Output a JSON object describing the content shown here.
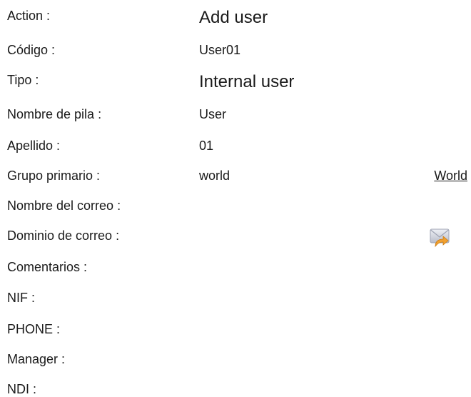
{
  "fields": {
    "action": {
      "label": "Action :",
      "value": "Add user"
    },
    "codigo": {
      "label": "Código :",
      "value": "User01"
    },
    "tipo": {
      "label": "Tipo :",
      "value": "Internal user"
    },
    "nombre_pila": {
      "label": "Nombre de pila :",
      "value": "User"
    },
    "apellido": {
      "label": "Apellido :",
      "value": "01"
    },
    "grupo_primario": {
      "label": "Grupo primario :",
      "value": "world",
      "link": "World"
    },
    "nombre_correo": {
      "label": "Nombre del correo :",
      "value": ""
    },
    "dominio_correo": {
      "label": "Dominio de correo :",
      "value": "",
      "icon": "mail-reply-icon"
    },
    "comentarios": {
      "label": "Comentarios :",
      "value": ""
    },
    "nif": {
      "label": "NIF :",
      "value": ""
    },
    "phone": {
      "label": "PHONE :",
      "value": ""
    },
    "manager": {
      "label": "Manager :",
      "value": ""
    },
    "ndi": {
      "label": "NDI :",
      "value": ""
    }
  },
  "colors": {
    "text": "#1a1a1a",
    "envelope": "#c9ccd6",
    "arrow": "#f0a030"
  }
}
